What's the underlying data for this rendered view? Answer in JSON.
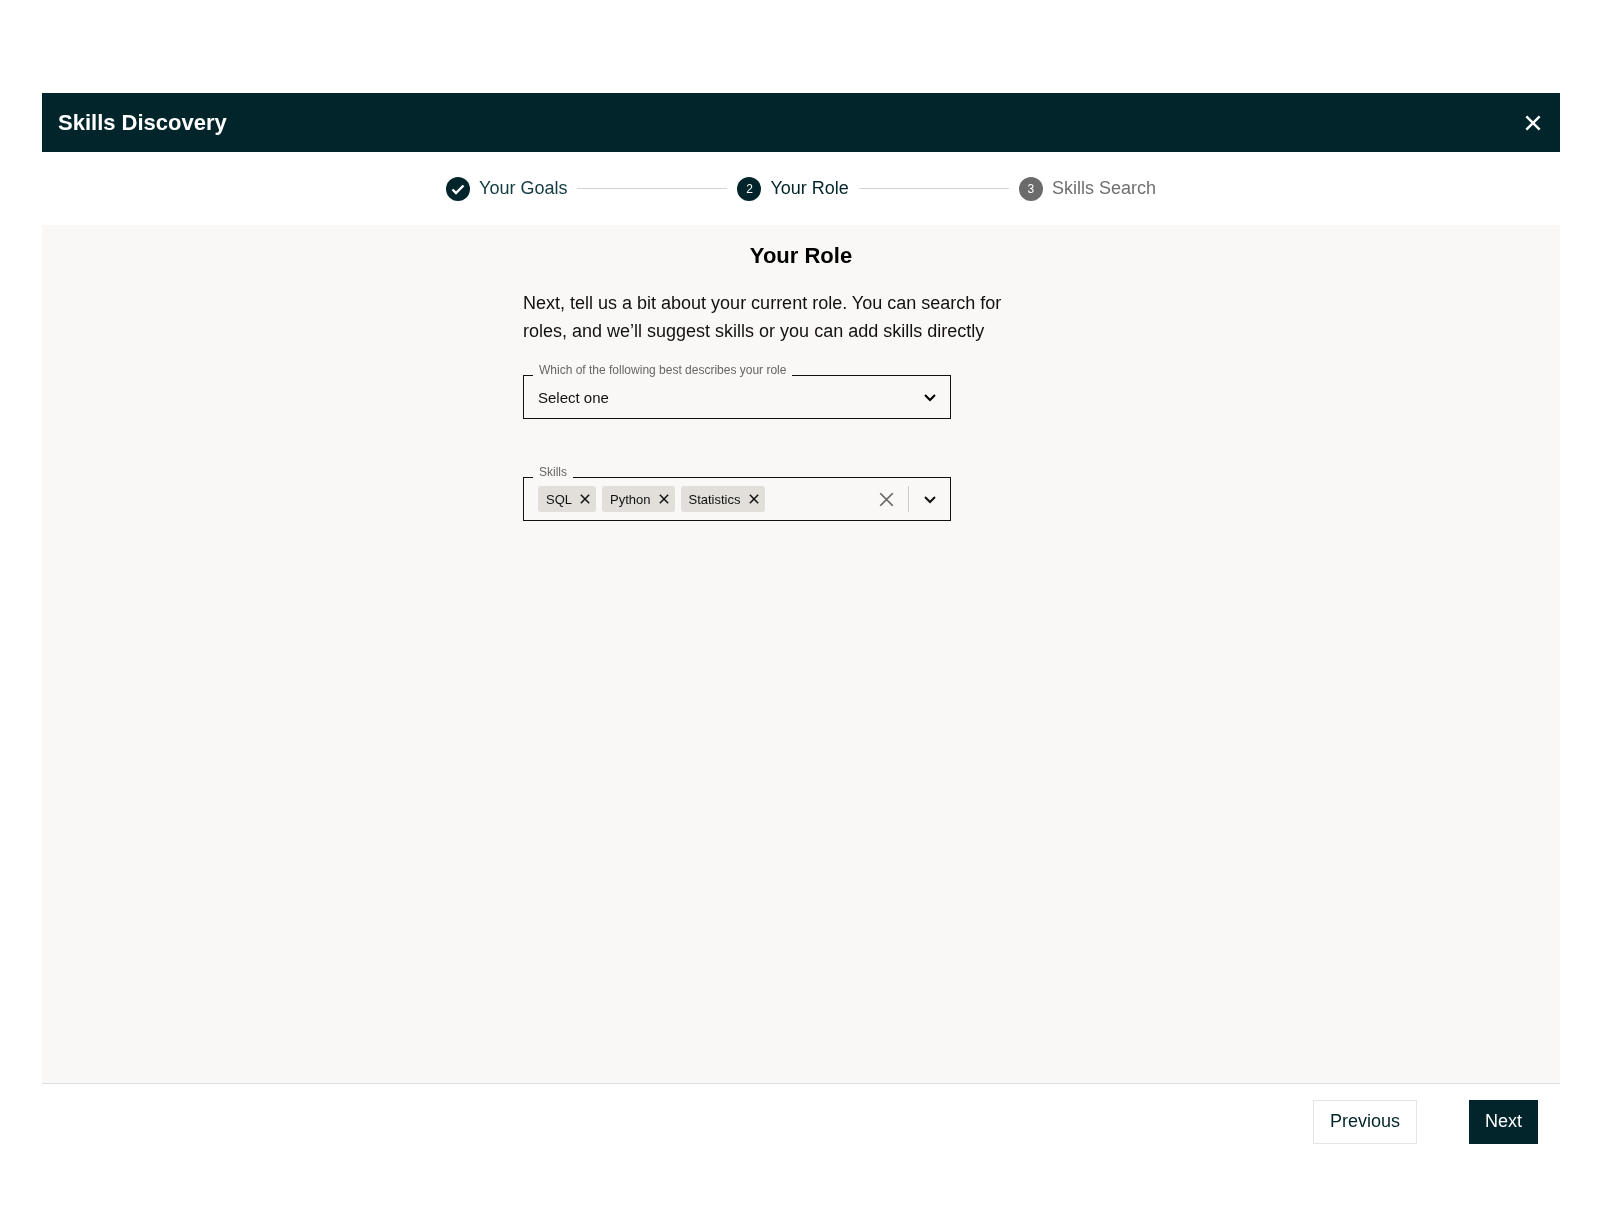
{
  "dialog": {
    "title": "Skills Discovery"
  },
  "steps": [
    {
      "label": "Your Goals",
      "completed": true,
      "selected": false
    },
    {
      "label": "Your Role",
      "completed": false,
      "selected": true,
      "number": "2"
    },
    {
      "label": "Skills Search",
      "completed": false,
      "selected": false,
      "number": "3"
    }
  ],
  "section": {
    "title": "Your Role",
    "description": "Next, tell us a bit about your current role. You can search for roles, and we’ll suggest skills or you can add skills directly"
  },
  "role_field": {
    "label": "Which of the following best describes your role",
    "value": "Select one"
  },
  "skills_field": {
    "label": "Skills",
    "tags": [
      "SQL",
      "Python",
      "Statistics"
    ]
  },
  "buttons": [
    {
      "label": "Previous",
      "kind": "secondary"
    },
    {
      "label": "Next",
      "kind": "primary"
    }
  ]
}
